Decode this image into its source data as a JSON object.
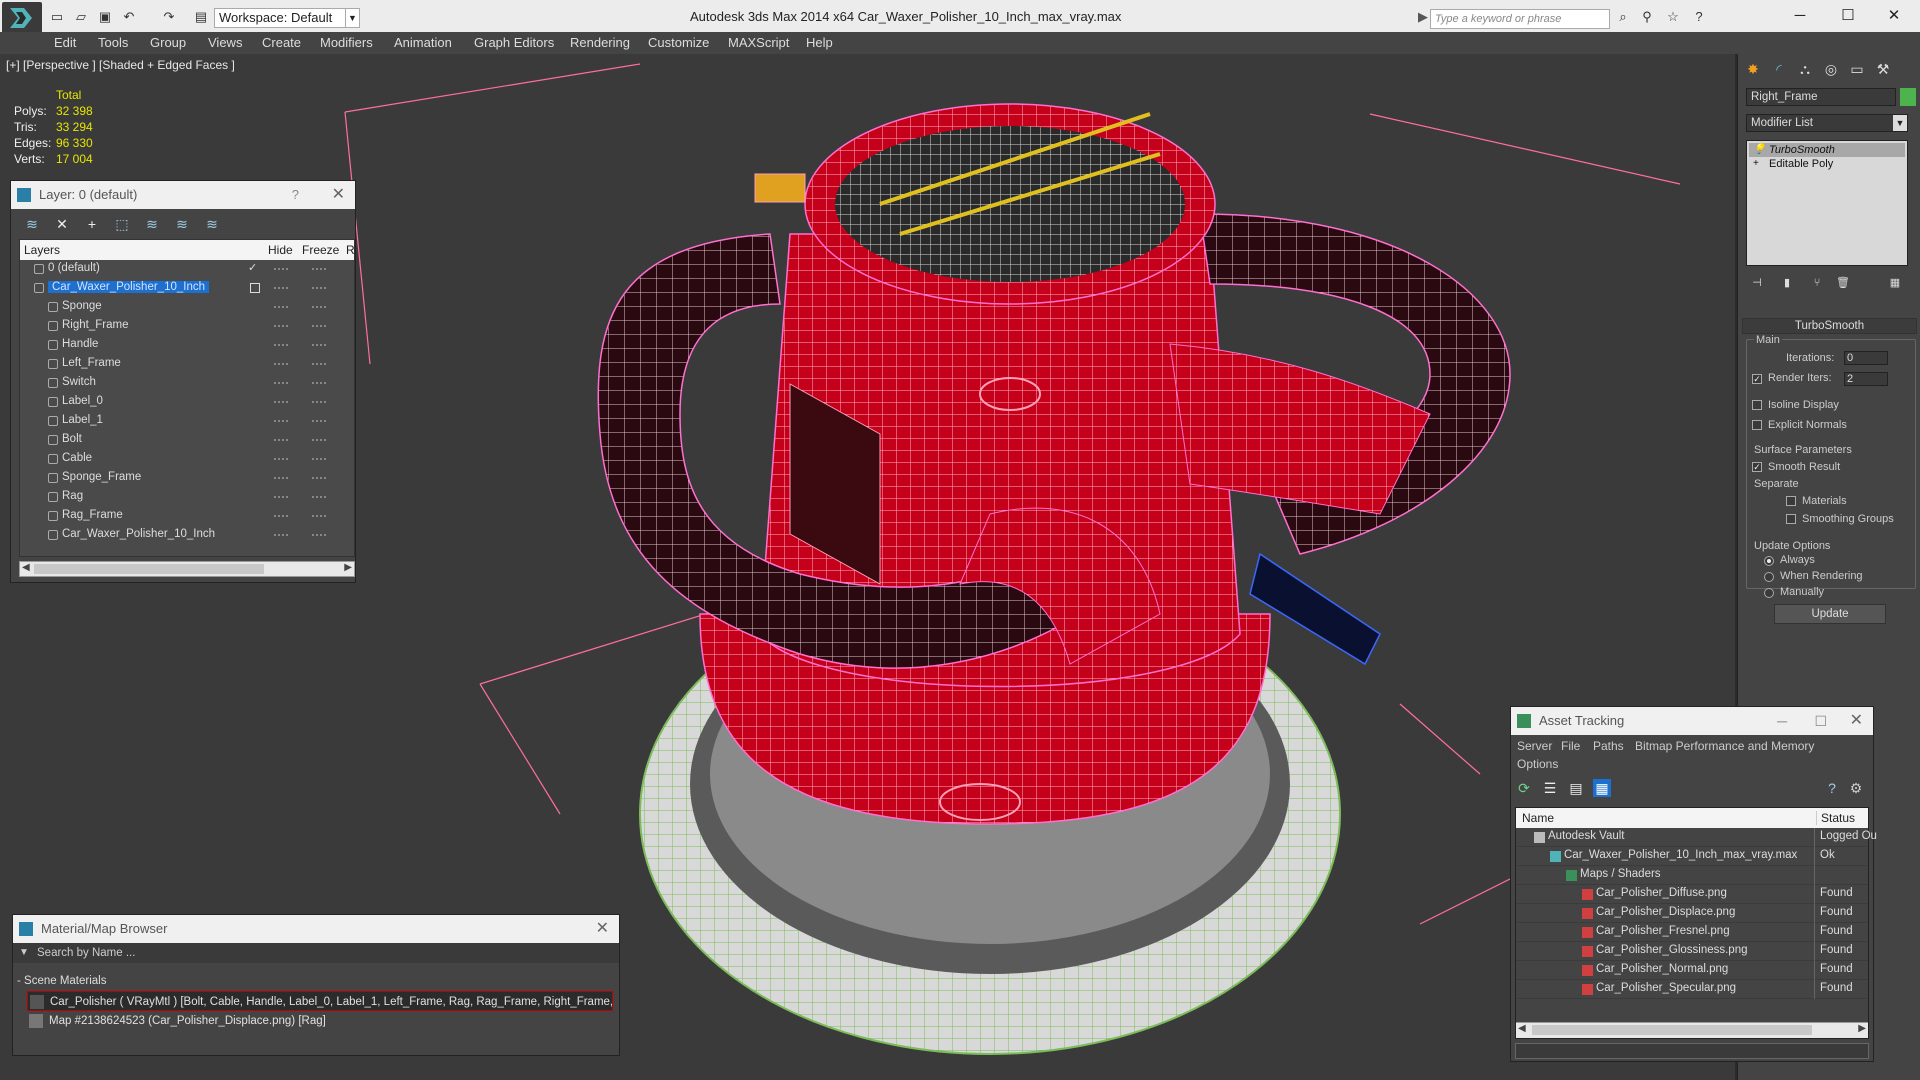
{
  "app": {
    "title": "Autodesk 3ds Max  2014 x64     Car_Waxer_Polisher_10_Inch_max_vray.max",
    "workspace": "Workspace: Default",
    "search_placeholder": "Type a keyword or phrase"
  },
  "menu": [
    "Edit",
    "Tools",
    "Group",
    "Views",
    "Create",
    "Modifiers",
    "Animation",
    "Graph Editors",
    "Rendering",
    "Customize",
    "MAXScript",
    "Help"
  ],
  "viewport": {
    "label": "[+] [Perspective ] [Shaded + Edged Faces ]",
    "stats": {
      "total_label": "Total",
      "rows": [
        {
          "k": "Polys:",
          "v": "32 398"
        },
        {
          "k": "Tris:",
          "v": "33 294"
        },
        {
          "k": "Edges:",
          "v": "96 330"
        },
        {
          "k": "Verts:",
          "v": "17 004"
        }
      ]
    }
  },
  "layer_panel": {
    "title": "Layer: 0 (default)",
    "help": "?",
    "columns": {
      "layers": "Layers",
      "hide": "Hide",
      "freeze": "Freeze",
      "render": "R"
    },
    "rows": [
      {
        "name": "0 (default)",
        "indent": 0,
        "check": true
      },
      {
        "name": "Car_Waxer_Polisher_10_Inch",
        "indent": 0,
        "selected": true
      },
      {
        "name": "Sponge",
        "indent": 1
      },
      {
        "name": "Right_Frame",
        "indent": 1
      },
      {
        "name": "Handle",
        "indent": 1
      },
      {
        "name": "Left_Frame",
        "indent": 1
      },
      {
        "name": "Switch",
        "indent": 1
      },
      {
        "name": "Label_0",
        "indent": 1
      },
      {
        "name": "Label_1",
        "indent": 1
      },
      {
        "name": "Bolt",
        "indent": 1
      },
      {
        "name": "Cable",
        "indent": 1
      },
      {
        "name": "Sponge_Frame",
        "indent": 1
      },
      {
        "name": "Rag",
        "indent": 1
      },
      {
        "name": "Rag_Frame",
        "indent": 1
      },
      {
        "name": "Car_Waxer_Polisher_10_Inch",
        "indent": 1
      }
    ]
  },
  "material_browser": {
    "title": "Material/Map Browser",
    "search": "Search by Name ...",
    "section": "- Scene Materials",
    "rows": [
      "Car_Polisher  ( VRayMtl )  [Bolt, Cable, Handle, Label_0, Label_1, Left_Frame, Rag, Rag_Frame, Right_Frame, Sponge, Sponge_Frame, Switch]",
      "Map #2138624523 (Car_Polisher_Displace.png)  [Rag]"
    ]
  },
  "command_panel": {
    "object_name": "Right_Frame",
    "modifier_list": "Modifier List",
    "stack": [
      "TurboSmooth",
      "Editable Poly"
    ],
    "rollout_title": "TurboSmooth",
    "main_label": "Main",
    "iterations_label": "Iterations:",
    "iterations": "0",
    "render_iters_label": "Render Iters:",
    "render_iters": "2",
    "isoline": "Isoline Display",
    "explicit_normals": "Explicit Normals",
    "surface_params": "Surface Parameters",
    "smooth_result": "Smooth Result",
    "separate": "Separate",
    "materials": "Materials",
    "smoothing_groups": "Smoothing Groups",
    "update_options": "Update Options",
    "always": "Always",
    "when_rendering": "When Rendering",
    "manually": "Manually",
    "update_btn": "Update"
  },
  "asset_tracking": {
    "title": "Asset Tracking",
    "menu": [
      "Server",
      "File",
      "Paths",
      "Bitmap Performance and Memory",
      "Options"
    ],
    "columns": {
      "name": "Name",
      "status": "Status"
    },
    "rows": [
      {
        "name": "Autodesk Vault",
        "status": "Logged Ou",
        "indent": 0,
        "icon": "vault"
      },
      {
        "name": "Car_Waxer_Polisher_10_Inch_max_vray.max",
        "status": "Ok",
        "indent": 1,
        "icon": "max"
      },
      {
        "name": "Maps / Shaders",
        "status": "",
        "indent": 2,
        "icon": "maps"
      },
      {
        "name": "Car_Polisher_Diffuse.png",
        "status": "Found",
        "indent": 3,
        "icon": "png"
      },
      {
        "name": "Car_Polisher_Displace.png",
        "status": "Found",
        "indent": 3,
        "icon": "png"
      },
      {
        "name": "Car_Polisher_Fresnel.png",
        "status": "Found",
        "indent": 3,
        "icon": "png"
      },
      {
        "name": "Car_Polisher_Glossiness.png",
        "status": "Found",
        "indent": 3,
        "icon": "png"
      },
      {
        "name": "Car_Polisher_Normal.png",
        "status": "Found",
        "indent": 3,
        "icon": "png"
      },
      {
        "name": "Car_Polisher_Specular.png",
        "status": "Found",
        "indent": 3,
        "icon": "png"
      }
    ]
  },
  "colors": {
    "viewport_bg": "#3a3a3a",
    "model_red": "#c8001a",
    "wire": "#ff9fb8",
    "pad": "#d8d8d8",
    "select": "#1d6fd0"
  }
}
